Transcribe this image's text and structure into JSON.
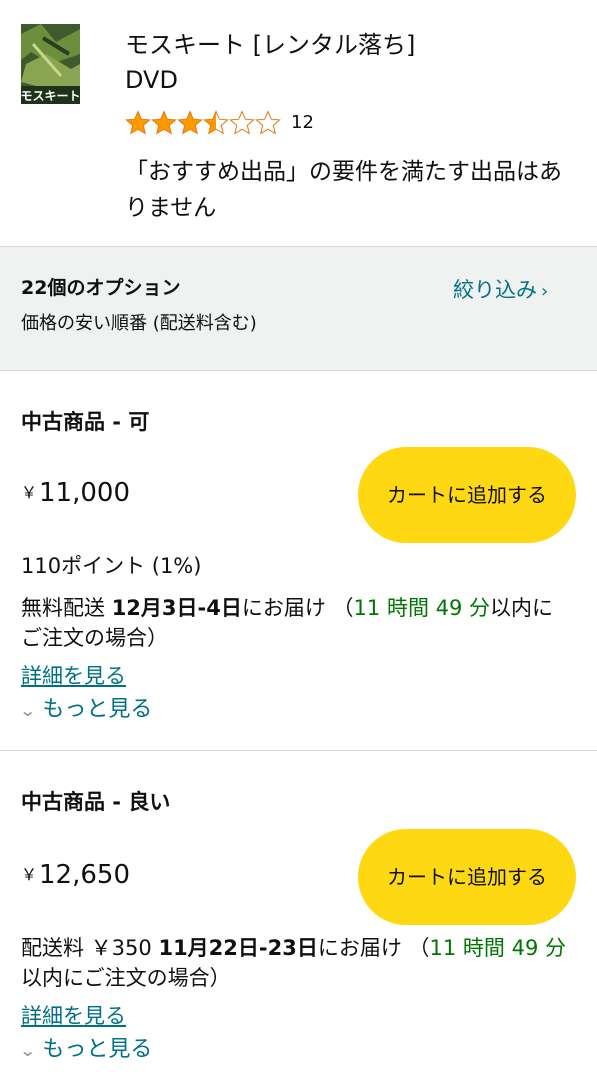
{
  "product": {
    "title": "モスキート [レンタル落ち]",
    "format": "DVD",
    "rating": 3.5,
    "rating_max": 5,
    "rating_count": "12",
    "notice": "「おすすめ出品」の要件を満たす出品はありません",
    "thumbnail_caption": "モスキート"
  },
  "filter": {
    "options_count": "22個のオプション",
    "sort_label": "価格の安い順番 (配送料含む)",
    "filter_link": "絞り込み"
  },
  "offers": [
    {
      "condition": "中古商品 - 可",
      "currency": "￥",
      "price": "11,000",
      "cart_label": "カートに追加する",
      "points": "110ポイント (1%)",
      "shipping": "無料配送",
      "delivery_date": "12月3日-4日",
      "delivery_suffix": "にお届け （",
      "countdown": "11 時間 49 分",
      "delivery_tail": "以内にご注文の場合）",
      "details_link": "詳細を見る",
      "more_link": "もっと見る"
    },
    {
      "condition": "中古商品 - 良い",
      "currency": "￥",
      "price": "12,650",
      "cart_label": "カートに追加する",
      "shipping": "配送料 ￥350",
      "delivery_date": "11月22日-23日",
      "delivery_suffix": "にお届け （",
      "countdown": "11 時間 49 分",
      "delivery_tail": "以内にご注文の場合）",
      "details_link": "詳細を見る",
      "more_link": "もっと見る"
    }
  ],
  "colors": {
    "star": "#ff9900",
    "link": "#007185",
    "countdown": "#007600",
    "cart_button": "#ffd814",
    "filter_bg": "#f0f2f2"
  }
}
